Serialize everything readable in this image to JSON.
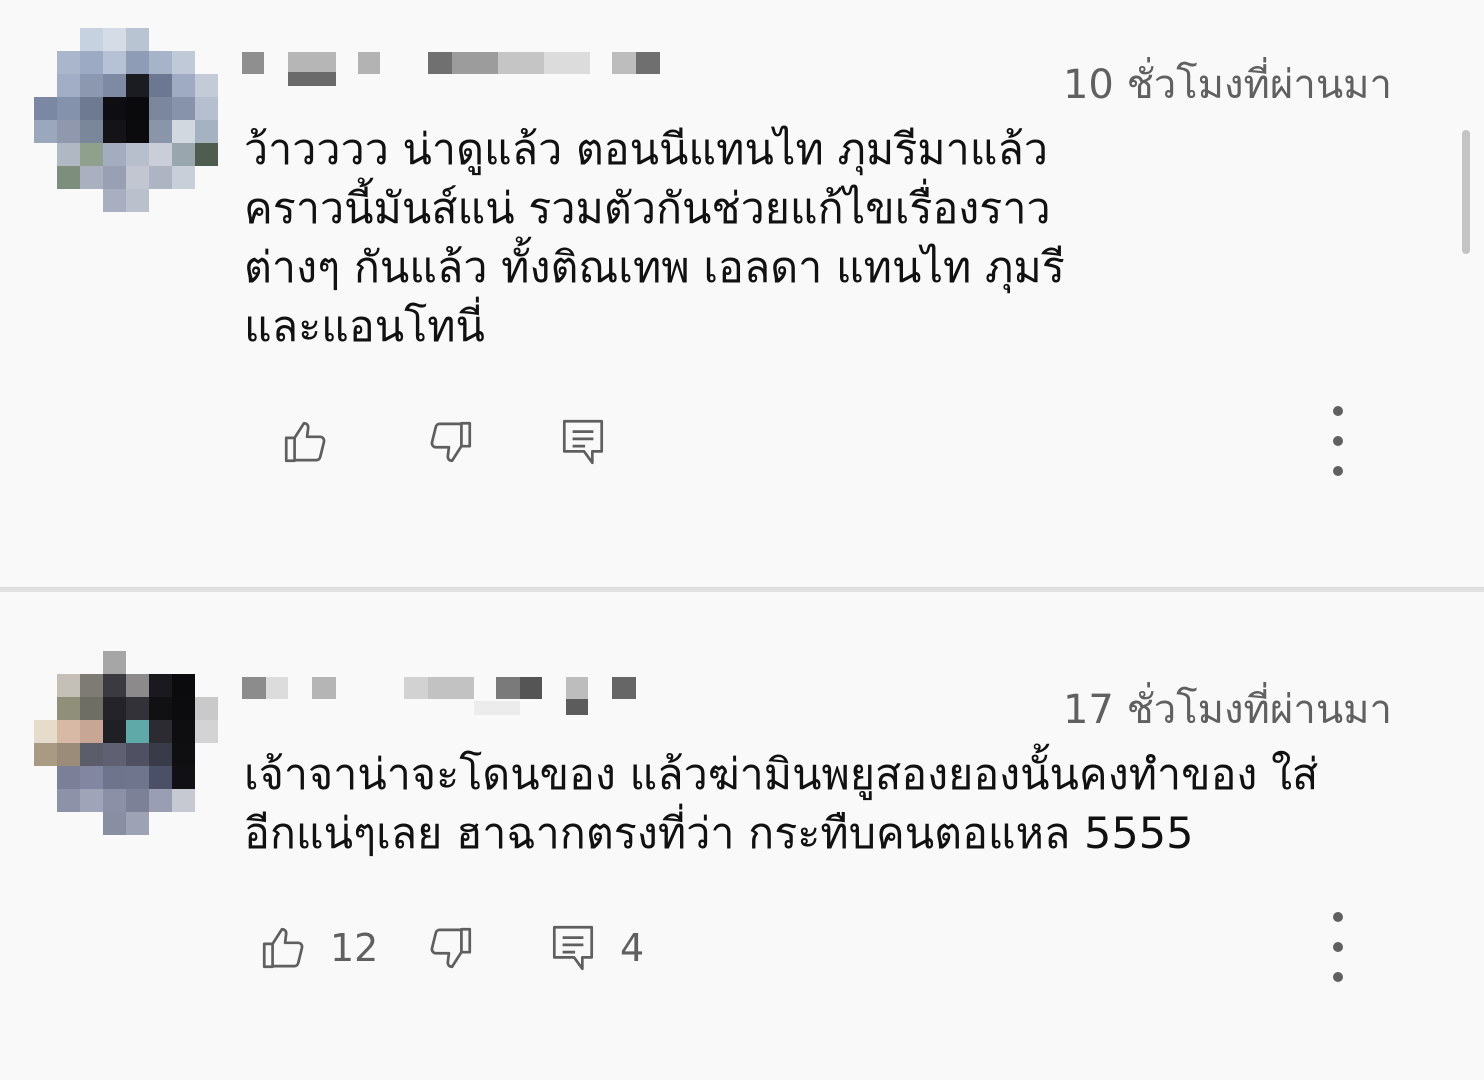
{
  "comments": [
    {
      "timestamp": "10 ชั่วโมงที่ผ่านมา",
      "text_lines": [
        "ว้าวววว น่าดูแล้ว ตอนนีแทนไท ภุมรีมาแล้ว",
        "คราวนี้มันส์แน่ รวมตัวกันช่วยแก้ไขเรื่องราว",
        "ต่างๆ กันแล้ว ทั้งติณเทพ เอลดา แทนไท ภุมรี",
        "และแอนโทนี่"
      ],
      "icons": {
        "like": "thumbs-up-icon",
        "dislike": "thumbs-down-icon",
        "reply": "reply-comment-icon",
        "more": "more-vertical-icon"
      }
    },
    {
      "timestamp": "17 ชั่วโมงที่ผ่านมา",
      "text_lines": [
        "เจ้าจาน่าจะโดนของ แล้วฆ่ามินพยูสองยองนั้นคงทำของ ใส่",
        "อีกแน่ๆเลย ฮาฉากตรงที่ว่า กระทืบคนตอแหล 5555"
      ],
      "like_count": "12",
      "reply_count": "4",
      "icons": {
        "like": "thumbs-up-icon",
        "dislike": "thumbs-down-icon",
        "reply": "reply-comment-icon",
        "more": "more-vertical-icon"
      }
    }
  ],
  "colors": {
    "background": "#f9f9f9",
    "text": "#111111",
    "secondary_text": "#606060",
    "divider": "#e0e0e0"
  }
}
